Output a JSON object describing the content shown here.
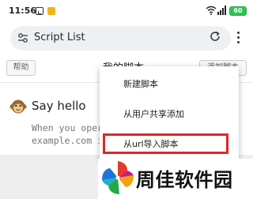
{
  "status_bar": {
    "time": "11:56",
    "battery": "60"
  },
  "address_bar": {
    "text": "Script List"
  },
  "header": {
    "help_label": "帮助",
    "title": "我的脚本",
    "add_label": "添加脚本"
  },
  "scripts": [
    {
      "title": "Say hello",
      "desc_line1": "When you oper",
      "desc_line2": "example.com i"
    }
  ],
  "menu": {
    "items": [
      {
        "label": "新建脚本"
      },
      {
        "label": "从用户共享添加"
      },
      {
        "label": "从url导入脚本"
      }
    ]
  },
  "watermark": {
    "text": "周佳软件园"
  },
  "colors": {
    "highlight": "#e0262b",
    "accent": "#2ec454"
  }
}
